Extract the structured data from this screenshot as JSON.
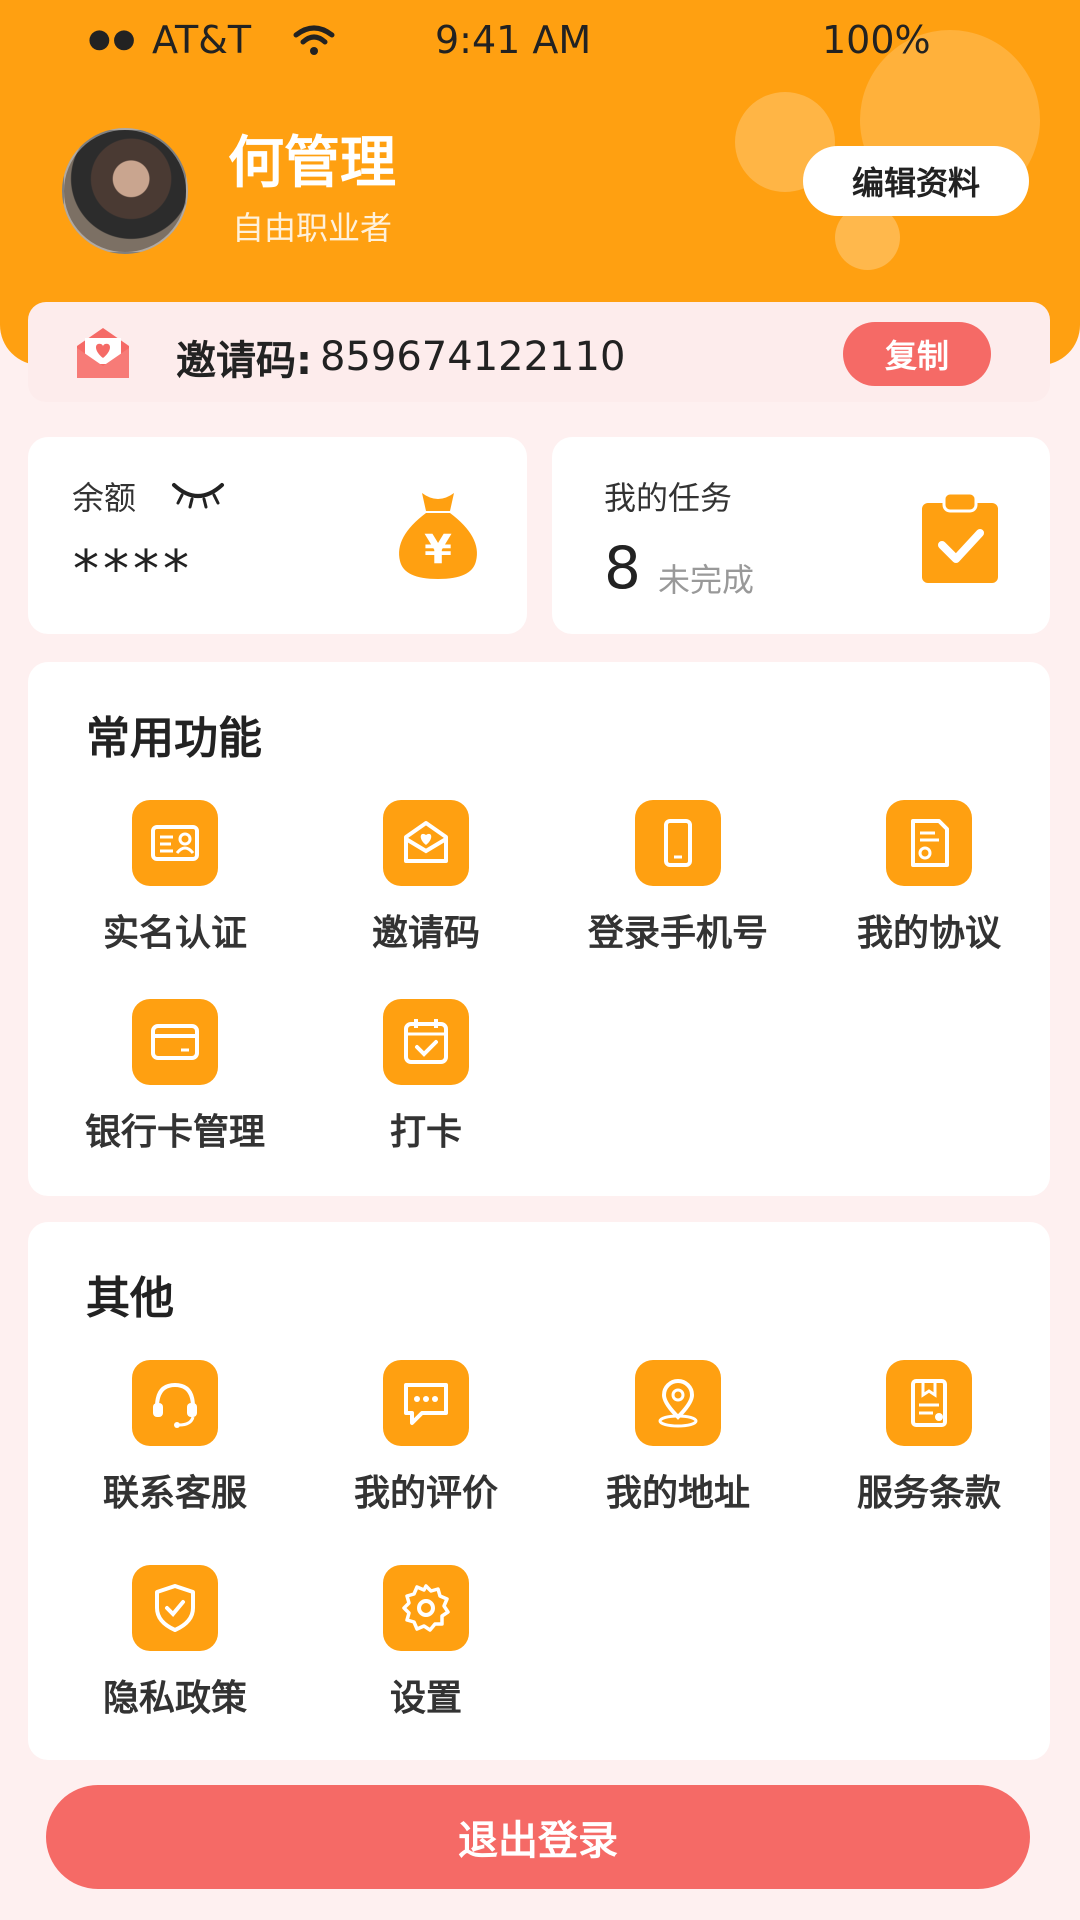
{
  "status_bar": {
    "dots": "●●",
    "carrier": "AT&T",
    "time": "9:41 AM",
    "battery": "100%"
  },
  "profile": {
    "name": "何管理",
    "title": "自由职业者",
    "edit_label": "编辑资料"
  },
  "invite": {
    "label": "邀请码:",
    "code": "859674122110",
    "copy_label": "复制"
  },
  "balance": {
    "label": "余额",
    "value": "****"
  },
  "tasks": {
    "label": "我的任务",
    "count": "8",
    "status": "未完成"
  },
  "common": {
    "title": "常用功能",
    "items": [
      {
        "label": "实名认证",
        "icon": "id-card-icon"
      },
      {
        "label": "邀请码",
        "icon": "envelope-heart-icon"
      },
      {
        "label": "登录手机号",
        "icon": "phone-icon"
      },
      {
        "label": "我的协议",
        "icon": "document-icon"
      },
      {
        "label": "银行卡管理",
        "icon": "bank-card-icon"
      },
      {
        "label": "打卡",
        "icon": "calendar-check-icon"
      }
    ]
  },
  "other": {
    "title": "其他",
    "items": [
      {
        "label": "联系客服",
        "icon": "headset-icon"
      },
      {
        "label": "我的评价",
        "icon": "chat-bubble-icon"
      },
      {
        "label": "我的地址",
        "icon": "location-pin-icon"
      },
      {
        "label": "服务条款",
        "icon": "terms-icon"
      },
      {
        "label": "隐私政策",
        "icon": "shield-check-icon"
      },
      {
        "label": "设置",
        "icon": "gear-icon"
      }
    ]
  },
  "logout_label": "退出登录",
  "colors": {
    "primary": "#FFA011",
    "accent": "#F56A66",
    "background": "#FEF0F0"
  }
}
